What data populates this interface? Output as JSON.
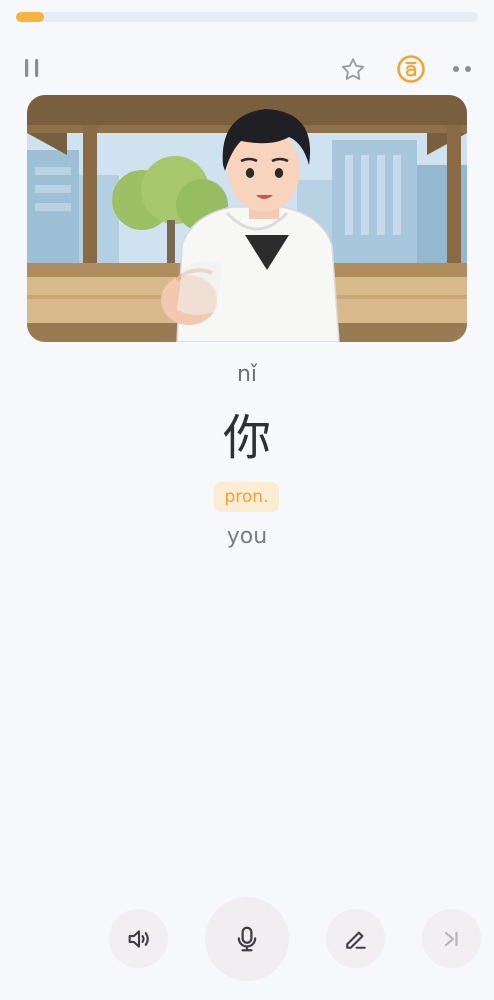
{
  "lesson": {
    "progress_fraction": 0.06
  },
  "card": {
    "pinyin": "nǐ",
    "hanzi": "你",
    "part_of_speech": "pron.",
    "meaning": "you"
  },
  "icons": {
    "pause": "pause-icon",
    "favorite": "star-icon",
    "pinyin_toggle": "pinyin-toggle-icon",
    "more": "more-icon",
    "sound": "speaker-icon",
    "mic": "microphone-icon",
    "edit": "pencil-icon",
    "skip": "skip-icon"
  },
  "colors": {
    "accent": "#f8b43c",
    "background": "#f6f8fc",
    "badge_bg": "#fdecd4",
    "badge_text": "#e9a53a"
  }
}
